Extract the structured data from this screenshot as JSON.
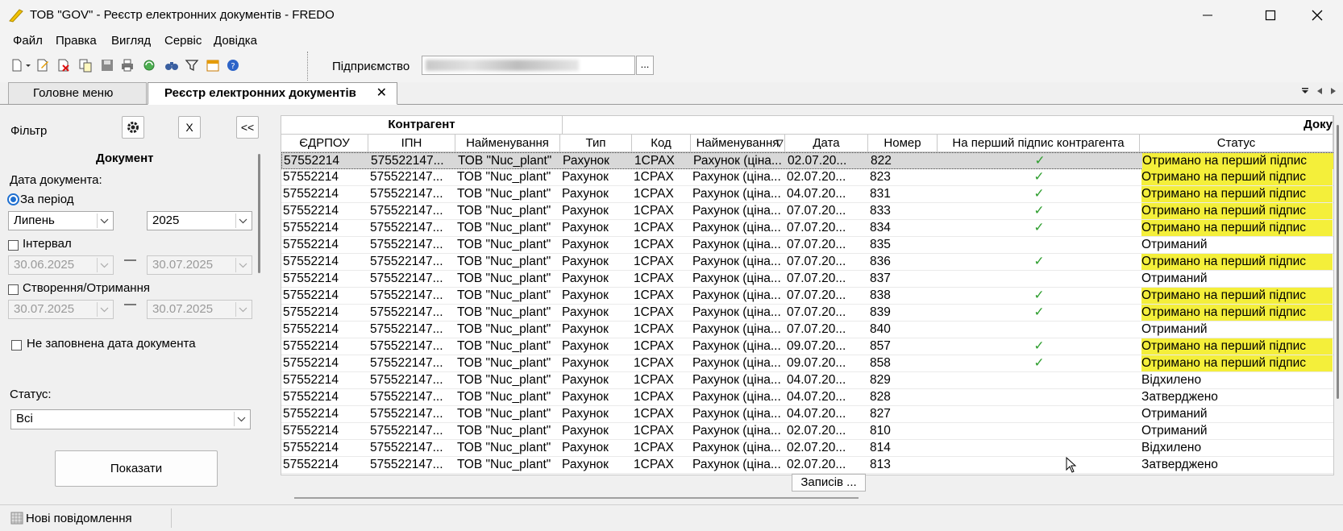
{
  "window": {
    "title": "ТОВ \"GOV\" - Реєстр електронних документів - FREDO",
    "minimize": "—",
    "maximize": "☐",
    "close": "✕"
  },
  "menu": [
    "Файл",
    "Правка",
    "Вигляд",
    "Сервіс",
    "Довідка"
  ],
  "toolbar": {
    "enterprise_label": "Підприємство",
    "browse_button": "..."
  },
  "tabs": {
    "main": "Головне меню",
    "active": "Реєстр електронних документів",
    "close": "✕"
  },
  "filter": {
    "title": "Фільтр",
    "clear_button": "X",
    "collapse_button": "<<",
    "section": "Документ",
    "date_label": "Дата документа:",
    "period_label": "За період",
    "month": "Липень",
    "year": "2025",
    "interval_label": "Інтервал",
    "interval_from": "30.06.2025",
    "interval_to": "30.07.2025",
    "interval_dash": "—",
    "created_label": "Створення/Отримання",
    "created_from": "30.07.2025",
    "created_to": "30.07.2025",
    "not_filled_label": "Не заповнена дата документа",
    "status_label": "Статус:",
    "status_value": "Всі",
    "show_button": "Показати"
  },
  "grid": {
    "group_counterparty": "Контрагент",
    "group_document": "Доку",
    "columns": [
      "ЄДРПОУ",
      "ІПН",
      "Найменування",
      "Тип",
      "Код",
      "Найменування",
      "Дата",
      "Номер",
      "На перший підпис контрагента",
      "Статус"
    ],
    "rows": [
      {
        "edrpou": "57552214",
        "ipn": "575522147...",
        "name": "ТОВ \"Nuc_plant\"",
        "type": "Рахунок",
        "code": "1СРАХ",
        "docname": "Рахунок (ціна...",
        "date": "02.07.20...",
        "number": "822",
        "first": "✓",
        "status": "Отримано на перший підпис",
        "hl": true,
        "sel": true
      },
      {
        "edrpou": "57552214",
        "ipn": "575522147...",
        "name": "ТОВ \"Nuc_plant\"",
        "type": "Рахунок",
        "code": "1СРАХ",
        "docname": "Рахунок (ціна...",
        "date": "02.07.20...",
        "number": "823",
        "first": "✓",
        "status": "Отримано на перший підпис",
        "hl": true
      },
      {
        "edrpou": "57552214",
        "ipn": "575522147...",
        "name": "ТОВ \"Nuc_plant\"",
        "type": "Рахунок",
        "code": "1СРАХ",
        "docname": "Рахунок (ціна...",
        "date": "04.07.20...",
        "number": "831",
        "first": "✓",
        "status": "Отримано на перший підпис",
        "hl": true
      },
      {
        "edrpou": "57552214",
        "ipn": "575522147...",
        "name": "ТОВ \"Nuc_plant\"",
        "type": "Рахунок",
        "code": "1СРАХ",
        "docname": "Рахунок (ціна...",
        "date": "07.07.20...",
        "number": "833",
        "first": "✓",
        "status": "Отримано на перший підпис",
        "hl": true
      },
      {
        "edrpou": "57552214",
        "ipn": "575522147...",
        "name": "ТОВ \"Nuc_plant\"",
        "type": "Рахунок",
        "code": "1СРАХ",
        "docname": "Рахунок (ціна...",
        "date": "07.07.20...",
        "number": "834",
        "first": "✓",
        "status": "Отримано на перший підпис",
        "hl": true
      },
      {
        "edrpou": "57552214",
        "ipn": "575522147...",
        "name": "ТОВ \"Nuc_plant\"",
        "type": "Рахунок",
        "code": "1СРАХ",
        "docname": "Рахунок (ціна...",
        "date": "07.07.20...",
        "number": "835",
        "first": "",
        "status": "Отриманий",
        "hl": false
      },
      {
        "edrpou": "57552214",
        "ipn": "575522147...",
        "name": "ТОВ \"Nuc_plant\"",
        "type": "Рахунок",
        "code": "1СРАХ",
        "docname": "Рахунок (ціна...",
        "date": "07.07.20...",
        "number": "836",
        "first": "✓",
        "status": "Отримано на перший підпис",
        "hl": true
      },
      {
        "edrpou": "57552214",
        "ipn": "575522147...",
        "name": "ТОВ \"Nuc_plant\"",
        "type": "Рахунок",
        "code": "1СРАХ",
        "docname": "Рахунок (ціна...",
        "date": "07.07.20...",
        "number": "837",
        "first": "",
        "status": "Отриманий",
        "hl": false
      },
      {
        "edrpou": "57552214",
        "ipn": "575522147...",
        "name": "ТОВ \"Nuc_plant\"",
        "type": "Рахунок",
        "code": "1СРАХ",
        "docname": "Рахунок (ціна...",
        "date": "07.07.20...",
        "number": "838",
        "first": "✓",
        "status": "Отримано на перший підпис",
        "hl": true
      },
      {
        "edrpou": "57552214",
        "ipn": "575522147...",
        "name": "ТОВ \"Nuc_plant\"",
        "type": "Рахунок",
        "code": "1СРАХ",
        "docname": "Рахунок (ціна...",
        "date": "07.07.20...",
        "number": "839",
        "first": "✓",
        "status": "Отримано на перший підпис",
        "hl": true
      },
      {
        "edrpou": "57552214",
        "ipn": "575522147...",
        "name": "ТОВ \"Nuc_plant\"",
        "type": "Рахунок",
        "code": "1СРАХ",
        "docname": "Рахунок (ціна...",
        "date": "07.07.20...",
        "number": "840",
        "first": "",
        "status": "Отриманий",
        "hl": false
      },
      {
        "edrpou": "57552214",
        "ipn": "575522147...",
        "name": "ТОВ \"Nuc_plant\"",
        "type": "Рахунок",
        "code": "1СРАХ",
        "docname": "Рахунок (ціна...",
        "date": "09.07.20...",
        "number": "857",
        "first": "✓",
        "status": "Отримано на перший підпис",
        "hl": true
      },
      {
        "edrpou": "57552214",
        "ipn": "575522147...",
        "name": "ТОВ \"Nuc_plant\"",
        "type": "Рахунок",
        "code": "1СРАХ",
        "docname": "Рахунок (ціна...",
        "date": "09.07.20...",
        "number": "858",
        "first": "✓",
        "status": "Отримано на перший підпис",
        "hl": true
      },
      {
        "edrpou": "57552214",
        "ipn": "575522147...",
        "name": "ТОВ \"Nuc_plant\"",
        "type": "Рахунок",
        "code": "1СРАХ",
        "docname": "Рахунок (ціна...",
        "date": "04.07.20...",
        "number": "829",
        "first": "",
        "status": "Відхилено",
        "hl": false
      },
      {
        "edrpou": "57552214",
        "ipn": "575522147...",
        "name": "ТОВ \"Nuc_plant\"",
        "type": "Рахунок",
        "code": "1СРАХ",
        "docname": "Рахунок (ціна...",
        "date": "04.07.20...",
        "number": "828",
        "first": "",
        "status": "Затверджено",
        "hl": false
      },
      {
        "edrpou": "57552214",
        "ipn": "575522147...",
        "name": "ТОВ \"Nuc_plant\"",
        "type": "Рахунок",
        "code": "1СРАХ",
        "docname": "Рахунок (ціна...",
        "date": "04.07.20...",
        "number": "827",
        "first": "",
        "status": "Отриманий",
        "hl": false
      },
      {
        "edrpou": "57552214",
        "ipn": "575522147...",
        "name": "ТОВ \"Nuc_plant\"",
        "type": "Рахунок",
        "code": "1СРАХ",
        "docname": "Рахунок (ціна...",
        "date": "02.07.20...",
        "number": "810",
        "first": "",
        "status": "Отриманий",
        "hl": false
      },
      {
        "edrpou": "57552214",
        "ipn": "575522147...",
        "name": "ТОВ \"Nuc_plant\"",
        "type": "Рахунок",
        "code": "1СРАХ",
        "docname": "Рахунок (ціна...",
        "date": "02.07.20...",
        "number": "814",
        "first": "",
        "status": "Відхилено",
        "hl": false
      },
      {
        "edrpou": "57552214",
        "ipn": "575522147...",
        "name": "ТОВ \"Nuc_plant\"",
        "type": "Рахунок",
        "code": "1СРАХ",
        "docname": "Рахунок (ціна...",
        "date": "02.07.20...",
        "number": "813",
        "first": "",
        "status": "Затверджено",
        "hl": false
      }
    ],
    "records_button": "Записів ..."
  },
  "statusbar": {
    "messages": "Нові повідомлення"
  },
  "colors": {
    "highlight": "#f4ef3a",
    "check": "#2e9e2e",
    "accent": "#1e6fd0"
  }
}
